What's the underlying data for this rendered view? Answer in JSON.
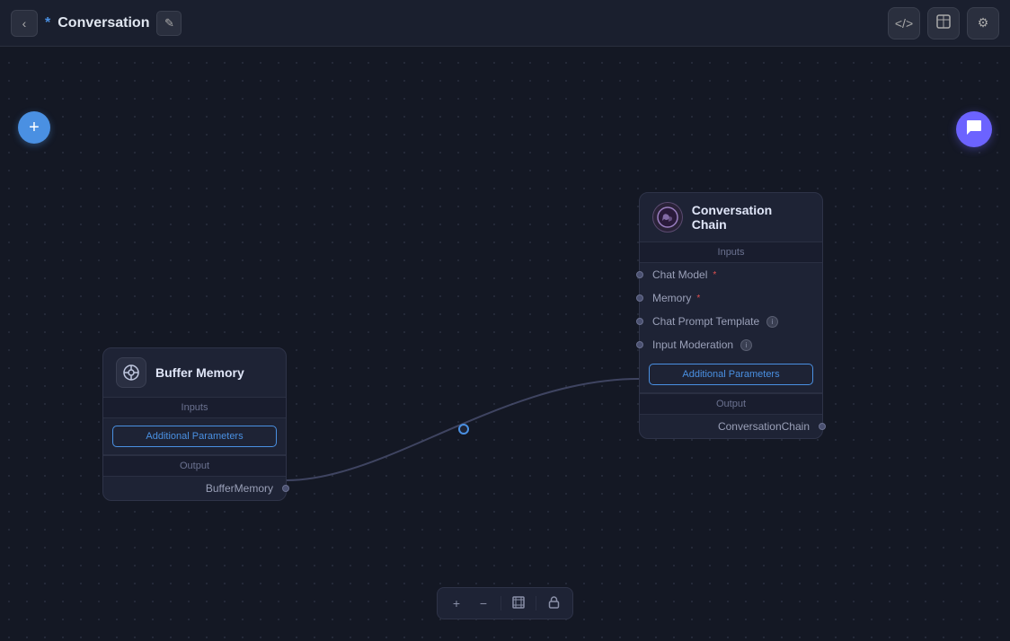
{
  "header": {
    "back_label": "‹",
    "title_asterisk": "*",
    "title": "Conversation",
    "edit_icon": "✏",
    "actions": [
      {
        "name": "code-button",
        "icon": "</>"
      },
      {
        "name": "table-button",
        "icon": "⊞"
      },
      {
        "name": "settings-button",
        "icon": "⚙"
      }
    ]
  },
  "canvas": {
    "add_button_label": "+",
    "chat_icon": "💬"
  },
  "buffer_memory_node": {
    "title": "Buffer Memory",
    "icon_label": "⊙",
    "inputs_label": "Inputs",
    "additional_params_label": "Additional Parameters",
    "output_label": "Output",
    "output_port_label": "BufferMemory"
  },
  "conv_chain_node": {
    "title": "Conversation Chain",
    "icon_label": "CONV",
    "inputs_label": "Inputs",
    "inputs": [
      {
        "label": "Chat Model",
        "required": true
      },
      {
        "label": "Memory",
        "required": true
      },
      {
        "label": "Chat Prompt Template",
        "required": false,
        "info": true
      },
      {
        "label": "Input Moderation",
        "required": false,
        "info": true
      }
    ],
    "additional_params_label": "Additional Parameters",
    "output_label": "Output",
    "output_port_label": "ConversationChain"
  },
  "toolbar": {
    "zoom_in": "+",
    "zoom_out": "−",
    "fit": "⊡",
    "lock": "🔒"
  }
}
